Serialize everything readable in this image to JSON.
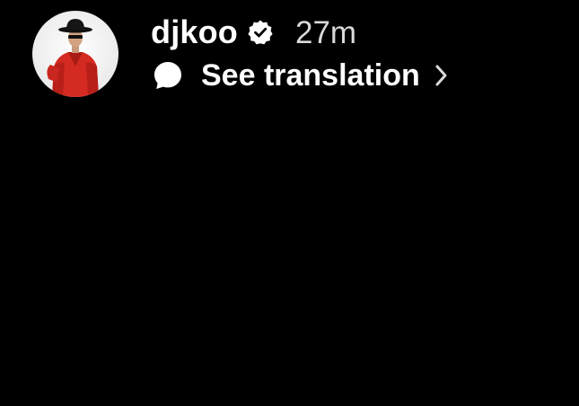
{
  "story": {
    "username": "djkoo",
    "time_ago": "27m",
    "translate_label": "See translation"
  },
  "icons": {
    "avatar": "profile-avatar",
    "verified": "verified-badge-icon",
    "speech": "speech-bubble-icon",
    "chevron": "chevron-right-icon"
  },
  "colors": {
    "background": "#000000",
    "text": "#ffffff",
    "muted_text": "#d9d9d9",
    "jacket": "#d42a22"
  }
}
